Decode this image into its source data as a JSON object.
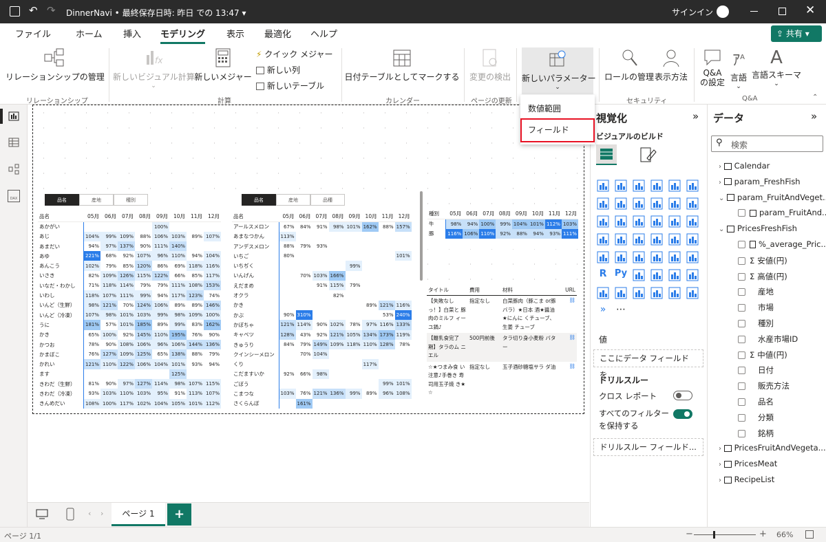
{
  "titlebar": {
    "title": "DinnerNavi • 最終保存日時: 昨日 での 13:47 ▾",
    "signin": "サインイン"
  },
  "tabs": [
    "ファイル",
    "ホーム",
    "挿入",
    "モデリング",
    "表示",
    "最適化",
    "ヘルプ"
  ],
  "share_label": "共有",
  "ribbon": {
    "relationship_manage": "リレーションシップの管理",
    "new_visual_calc": "新しいビジュアル計算",
    "new_measure": "新しいメジャー",
    "quick_measure": "クイック メジャー",
    "new_column": "新しい列",
    "new_table": "新しいテーブル",
    "mark_date_table": "日付テーブルとしてマークする",
    "change_detect": "変更の検出",
    "new_parameter": "新しいパラメーター",
    "role_manage": "ロールの管理",
    "view_as": "表示方法",
    "qa_settings_1": "Q&A",
    "qa_settings_2": "の設定",
    "language": "言語",
    "lang_schema": "言語スキーマ",
    "groups": [
      "リレーションシップ",
      "計算",
      "カレンダー",
      "ページの更新",
      "セキュリティ",
      "Q&A"
    ]
  },
  "dropdown": {
    "items": [
      "数値範囲",
      "フィールド"
    ]
  },
  "slicer1": [
    "品名",
    "産地",
    "種別"
  ],
  "slicer2": [
    "品名",
    "産地",
    "品種"
  ],
  "months": [
    "05月",
    "06月",
    "07月",
    "08月",
    "09月",
    "10月",
    "11月",
    "12月"
  ],
  "matrix1": {
    "col0": "品名",
    "rows": [
      [
        "あかがい",
        "",
        "",
        "",
        "",
        "100%",
        "",
        "",
        ""
      ],
      [
        "あじ",
        "104%",
        "99%",
        "109%",
        "88%",
        "106%",
        "103%",
        "89%",
        "107%"
      ],
      [
        "あまだい",
        "94%",
        "97%",
        "137%",
        "90%",
        "111%",
        "140%",
        "",
        ""
      ],
      [
        "あゆ",
        "221%",
        "68%",
        "92%",
        "107%",
        "96%",
        "110%",
        "94%",
        "104%"
      ],
      [
        "あんこう",
        "102%",
        "79%",
        "85%",
        "120%",
        "86%",
        "69%",
        "118%",
        "116%"
      ],
      [
        "いさき",
        "82%",
        "109%",
        "126%",
        "115%",
        "122%",
        "66%",
        "85%",
        "117%"
      ],
      [
        "いなだ・わかし",
        "71%",
        "118%",
        "114%",
        "79%",
        "79%",
        "111%",
        "108%",
        "153%"
      ],
      [
        "いわし",
        "118%",
        "107%",
        "111%",
        "99%",
        "94%",
        "117%",
        "123%",
        "74%"
      ],
      [
        "いんど（生鮮）",
        "98%",
        "121%",
        "70%",
        "124%",
        "106%",
        "89%",
        "89%",
        "146%"
      ],
      [
        "いんど（冷凍）",
        "107%",
        "98%",
        "101%",
        "103%",
        "99%",
        "98%",
        "109%",
        "100%"
      ],
      [
        "うに",
        "181%",
        "57%",
        "101%",
        "185%",
        "89%",
        "99%",
        "83%",
        "162%"
      ],
      [
        "かき",
        "65%",
        "100%",
        "92%",
        "145%",
        "110%",
        "195%",
        "76%",
        "90%"
      ],
      [
        "かつお",
        "78%",
        "90%",
        "108%",
        "106%",
        "96%",
        "106%",
        "144%",
        "136%"
      ],
      [
        "かまぼこ",
        "76%",
        "127%",
        "109%",
        "125%",
        "65%",
        "138%",
        "88%",
        "79%"
      ],
      [
        "かれい",
        "121%",
        "110%",
        "122%",
        "106%",
        "104%",
        "101%",
        "93%",
        "94%"
      ],
      [
        "ます",
        "",
        "",
        "",
        "",
        "",
        "125%",
        "",
        ""
      ],
      [
        "きわだ（生鮮）",
        "81%",
        "90%",
        "97%",
        "127%",
        "114%",
        "98%",
        "107%",
        "115%"
      ],
      [
        "きわだ（冷凍）",
        "93%",
        "103%",
        "110%",
        "103%",
        "95%",
        "91%",
        "113%",
        "107%"
      ],
      [
        "きんめだい",
        "108%",
        "100%",
        "117%",
        "102%",
        "104%",
        "105%",
        "101%",
        "112%"
      ]
    ]
  },
  "matrix2": {
    "col0": "品名",
    "rows": [
      [
        "アールスメロン",
        "67%",
        "84%",
        "91%",
        "98%",
        "101%",
        "162%",
        "88%",
        "157%"
      ],
      [
        "あまなつかん",
        "113%",
        "",
        "",
        "",
        "",
        "",
        "",
        ""
      ],
      [
        "アンデスメロン",
        "88%",
        "79%",
        "93%",
        "",
        "",
        "",
        "",
        ""
      ],
      [
        "いちご",
        "80%",
        "",
        "",
        "",
        "",
        "",
        "",
        "101%"
      ],
      [
        "いちぢく",
        "",
        "",
        "",
        "",
        "99%",
        "",
        "",
        ""
      ],
      [
        "いんげん",
        "",
        "70%",
        "103%",
        "166%",
        "",
        "",
        "",
        ""
      ],
      [
        "えだまめ",
        "",
        "",
        "91%",
        "115%",
        "79%",
        "",
        "",
        ""
      ],
      [
        "オクラ",
        "",
        "",
        "",
        "82%",
        "",
        "",
        "",
        ""
      ],
      [
        "かき",
        "",
        "",
        "",
        "",
        "",
        "89%",
        "121%",
        "116%"
      ],
      [
        "かぶ",
        "90%",
        "310%",
        "",
        "",
        "",
        "",
        "53%",
        "240%"
      ],
      [
        "かぼちゃ",
        "121%",
        "114%",
        "90%",
        "102%",
        "78%",
        "97%",
        "116%",
        "133%"
      ],
      [
        "キャベツ",
        "128%",
        "43%",
        "92%",
        "121%",
        "105%",
        "134%",
        "173%",
        "119%"
      ],
      [
        "きゅうり",
        "84%",
        "79%",
        "149%",
        "109%",
        "118%",
        "110%",
        "128%",
        "78%"
      ],
      [
        "クインシーメロン",
        "",
        "70%",
        "104%",
        "",
        "",
        "",
        "",
        ""
      ],
      [
        "くり",
        "",
        "",
        "",
        "",
        "",
        "117%",
        "",
        ""
      ],
      [
        "こだますいか",
        "92%",
        "66%",
        "98%",
        "",
        "",
        "",
        "",
        ""
      ],
      [
        "ごぼう",
        "",
        "",
        "",
        "",
        "",
        "",
        "99%",
        "101%"
      ],
      [
        "こまつな",
        "103%",
        "76%",
        "121%",
        "136%",
        "99%",
        "89%",
        "96%",
        "108%"
      ],
      [
        "さくらんぼ",
        "",
        "161%",
        "",
        "",
        "",
        "",
        "",
        ""
      ]
    ]
  },
  "matrix3": {
    "col0": "種別",
    "rows": [
      [
        "牛",
        "98%",
        "94%",
        "100%",
        "99%",
        "104%",
        "101%",
        "112%",
        "103%"
      ],
      [
        "豚",
        "116%",
        "106%",
        "110%",
        "92%",
        "88%",
        "94%",
        "93%",
        "111%"
      ]
    ]
  },
  "recipe_table": {
    "headers": [
      "タイトル",
      "費用",
      "材料",
      "URL"
    ],
    "rows": [
      [
        "【失敗なし っ！】白菜と 豚肉のミルフ ィーユ鍋♪",
        "指定なし",
        "白菜豚肉（豚こま or豚バラ）★日本 酒★醤油★にんに くチューブ、生姜 チューブ"
      ],
      [
        "【離乳食完了 期】タラのム ニエル",
        "500円前後",
        "タラ切り身小麦粉 バター"
      ],
      [
        "☆★つまみ食 い注意♪手巻き 寿司用玉子焼 き★☆",
        "指定なし",
        "玉子酒砂糖塩サラ ダ油"
      ]
    ]
  },
  "pages": [
    "ページ 1"
  ],
  "status": {
    "page_info": "ページ 1/1",
    "zoom": "66%"
  },
  "viz_pane": {
    "title": "視覚化",
    "build": "ビジュアルのビルド",
    "value_label": "値",
    "value_placeholder": "ここにデータ フィールドを...",
    "drillthrough": "ドリルスルー",
    "cross_report": "クロス レポート",
    "keep_filters": "すべてのフィルター を保持する",
    "drill_field": "ドリルスルー フィールド..."
  },
  "data_pane": {
    "title": "データ",
    "search_placeholder": "検索",
    "items": [
      "Calendar",
      "param_FreshFish",
      "param_FruitAndVeget...",
      "param_FruitAnd...",
      "PricesFreshFish",
      "%_average_Pric...",
      "安値(円)",
      "高値(円)",
      "産地",
      "市場",
      "種別",
      "水産市場ID",
      "中値(円)",
      "日付",
      "販売方法",
      "品名",
      "分類",
      "銘柄",
      "PricesFruitAndVegeta...",
      "PricesMeat",
      "RecipeList"
    ]
  },
  "colors": {
    "accent": "#117865",
    "dark_cell": "#2b7de9",
    "highlight_red": "#e81123"
  }
}
